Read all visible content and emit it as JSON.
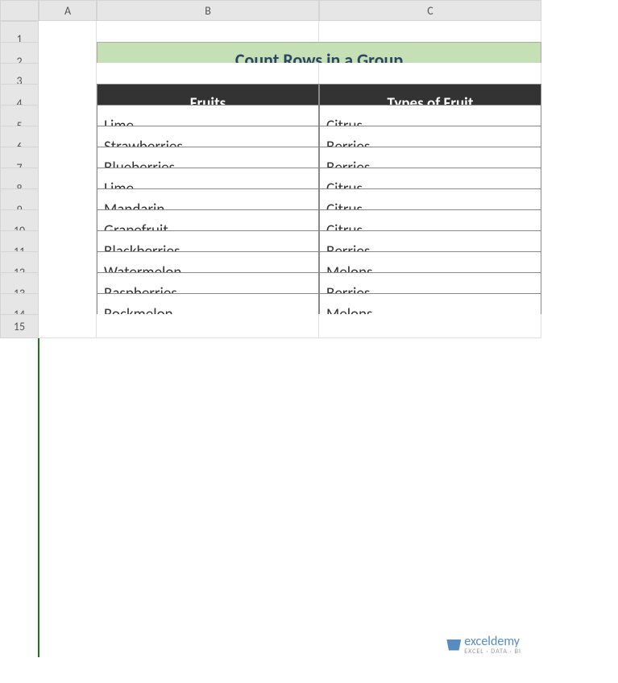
{
  "columns": [
    "A",
    "B",
    "C"
  ],
  "rowNumbers": [
    "1",
    "2",
    "3",
    "4",
    "5",
    "6",
    "7",
    "8",
    "9",
    "10",
    "11",
    "12",
    "13",
    "14",
    "15"
  ],
  "title": "Count Rows in a Group",
  "table": {
    "headers": {
      "col1": "Fruits",
      "col2": "Types of Fruit"
    },
    "rows": [
      {
        "fruit": "Lime",
        "type": "Citrus"
      },
      {
        "fruit": "Strawberries",
        "type": "Berries"
      },
      {
        "fruit": "Blueberries",
        "type": "Berries"
      },
      {
        "fruit": "Lime",
        "type": "Citrus"
      },
      {
        "fruit": "Mandarin",
        "type": "Citrus"
      },
      {
        "fruit": "Grapefruit",
        "type": "Citrus"
      },
      {
        "fruit": "Blackberries",
        "type": "Berries"
      },
      {
        "fruit": "Watermelon",
        "type": "Melons"
      },
      {
        "fruit": "Raspberries",
        "type": "Berries"
      },
      {
        "fruit": "Rockmelon",
        "type": "Melons"
      }
    ]
  },
  "watermark": {
    "brand": "exceldemy",
    "tagline": "EXCEL · DATA · BI"
  }
}
